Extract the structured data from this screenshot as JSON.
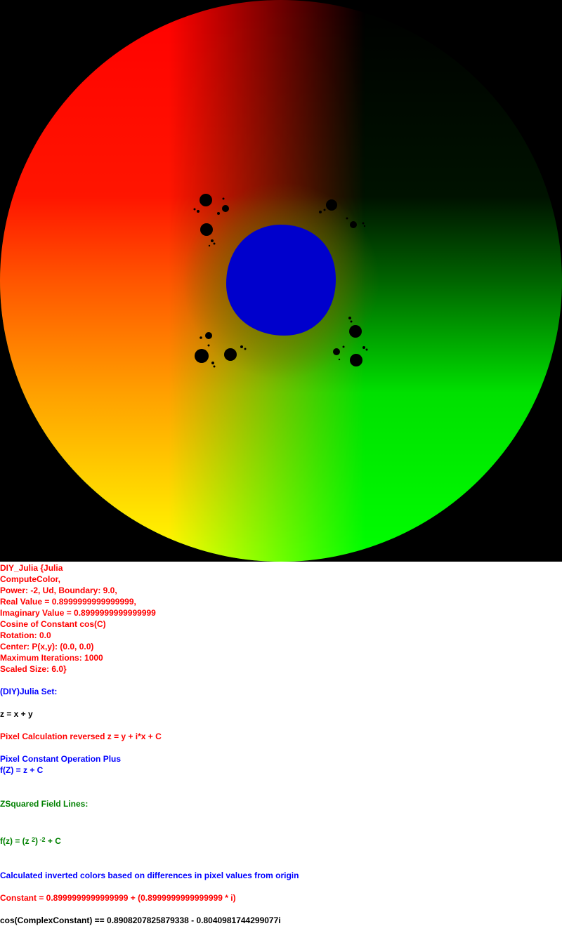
{
  "image": {
    "description_icon": "julia-fractal-image",
    "colors": {
      "background": "#000000",
      "disk_red": "#ff0000",
      "disk_yellow": "#ffff00",
      "disk_green": "#00ff00",
      "center_blob": "#0000cc",
      "islands": "#000000"
    }
  },
  "params": {
    "l1": "DIY_Julia {Julia",
    "l2": "ComputeColor,",
    "l3": "Power: -2, Ud, Boundary: 9.0,",
    "l4": "Real Value = 0.8999999999999999,",
    "l5": "Imaginary Value = 0.8999999999999999",
    "l6": "Cosine of Constant cos(C)",
    "l7": "Rotation: 0.0",
    "l8": "Center: P(x,y): (0.0, 0.0)",
    "l9": "Maximum Iterations: 1000",
    "l10": "Scaled Size: 6.0}"
  },
  "sections": {
    "set_title": "(DIY)Julia Set:",
    "z_def": "z = x + y",
    "pixel_calc": "Pixel Calculation reversed z = y + i*x + C",
    "const_op": "Pixel Constant Operation Plus",
    "fz": "f(Z) = z + C",
    "field_lines": "ZSquared Field Lines:",
    "formula": {
      "prefix": "f(z) = (z ",
      "inner_exp": "2",
      "mid": ")",
      "outer_exp": " -2",
      "suffix": " + C"
    },
    "colors_note": "Calculated inverted colors based on differences in pixel values from origin",
    "constant": "Constant = 0.8999999999999999 + (0.8999999999999999 * i)",
    "cos_constant": "cos(ComplexConstant) == 0.8908207825879338 - 0.8040981744299077i"
  }
}
